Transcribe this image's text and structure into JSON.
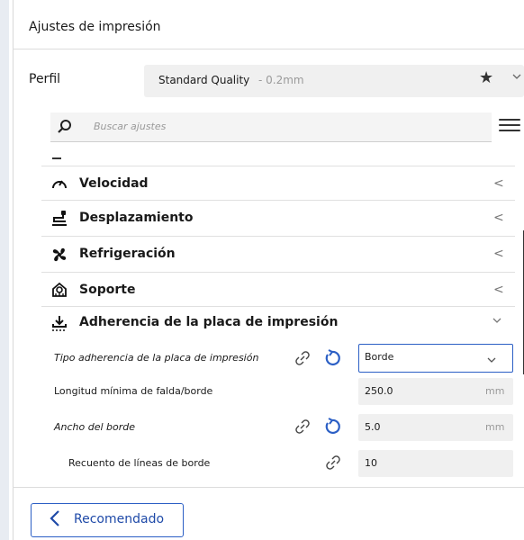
{
  "title": "Ajustes de impresión",
  "profile": {
    "label": "Perfil",
    "name": "Standard Quality",
    "variant": " - 0.2mm"
  },
  "search": {
    "placeholder": "Buscar ajustes"
  },
  "categories": [
    {
      "label": "Velocidad",
      "icon": "speedometer-icon",
      "chevron": "<"
    },
    {
      "label": "Desplazamiento",
      "icon": "travel-icon",
      "chevron": "<"
    },
    {
      "label": "Refrigeración",
      "icon": "fan-icon",
      "chevron": "<"
    },
    {
      "label": "Soporte",
      "icon": "support-icon",
      "chevron": "<"
    },
    {
      "label": "Adherencia de la placa de impresión",
      "icon": "adhesion-icon",
      "chevron": "v"
    }
  ],
  "settings": {
    "adhesion_type": {
      "label": "Tipo adherencia de la placa de impresión",
      "value": "Borde"
    },
    "min_skirt_length": {
      "label": "Longitud mínima de falda/borde",
      "value": "250.0",
      "unit": "mm"
    },
    "brim_width": {
      "label": "Ancho del borde",
      "value": "5.0",
      "unit": "mm"
    },
    "brim_line_count": {
      "label": "Recuento de líneas de borde",
      "value": "10"
    }
  },
  "footer": {
    "button": "Recomendado"
  },
  "colors": {
    "accent": "#2b5fc5"
  }
}
